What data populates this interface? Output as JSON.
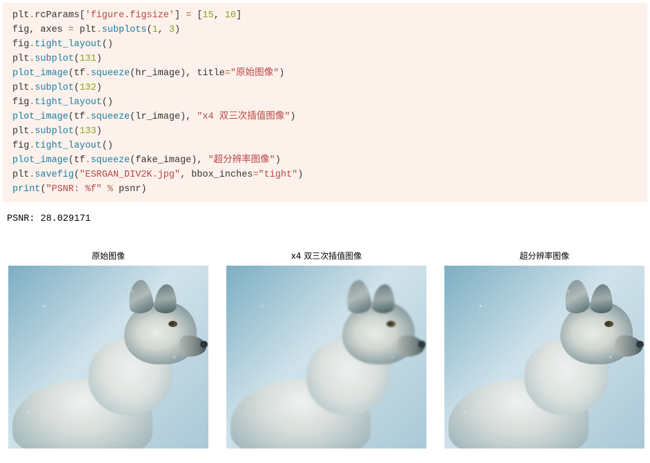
{
  "code": {
    "line1": {
      "a": "plt",
      "b": ".",
      "c": "rcParams",
      "d": "[",
      "e": "'figure.figsize'",
      "f": "]",
      "g": " ",
      "h": "=",
      "i": " [",
      "j": "15",
      "k": ", ",
      "l": "10",
      "m": "]"
    },
    "line2": {
      "a": "fig, axes ",
      "b": "=",
      "c": " plt",
      "d": ".",
      "e": "subplots",
      "f": "(",
      "g": "1",
      "h": ", ",
      "i": "3",
      "j": ")"
    },
    "line3": {
      "a": "fig",
      "b": ".",
      "c": "tight_layout",
      "d": "()"
    },
    "line4": {
      "a": "plt",
      "b": ".",
      "c": "subplot",
      "d": "(",
      "e": "131",
      "f": ")"
    },
    "line5": {
      "a": "plot_image",
      "b": "(tf",
      "c": ".",
      "d": "squeeze",
      "e": "(hr_image), title",
      "f": "=",
      "g": "\"原始图像\"",
      "h": ")"
    },
    "line6": {
      "a": "plt",
      "b": ".",
      "c": "subplot",
      "d": "(",
      "e": "132",
      "f": ")"
    },
    "line7": {
      "a": "fig",
      "b": ".",
      "c": "tight_layout",
      "d": "()"
    },
    "line8": {
      "a": "plot_image",
      "b": "(tf",
      "c": ".",
      "d": "squeeze",
      "e": "(lr_image), ",
      "f": "\"x4 双三次插值图像\"",
      "g": ")"
    },
    "line9": {
      "a": "plt",
      "b": ".",
      "c": "subplot",
      "d": "(",
      "e": "133",
      "f": ")"
    },
    "line10": {
      "a": "fig",
      "b": ".",
      "c": "tight_layout",
      "d": "()"
    },
    "line11": {
      "a": "plot_image",
      "b": "(tf",
      "c": ".",
      "d": "squeeze",
      "e": "(fake_image), ",
      "f": "\"超分辨率图像\"",
      "g": ")"
    },
    "line12": {
      "a": "plt",
      "b": ".",
      "c": "savefig",
      "d": "(",
      "e": "\"ESRGAN_DIV2K.jpg\"",
      "f": ", bbox_inches",
      "g": "=",
      "h": "\"tight\"",
      "i": ")"
    },
    "line13": {
      "a": "print",
      "b": "(",
      "c": "\"PSNR: %f\"",
      "d": " ",
      "e": "%",
      "f": " psnr)"
    }
  },
  "output": {
    "psnr_line": "PSNR: 28.029171"
  },
  "figure": {
    "subplots": [
      {
        "title": "原始图像"
      },
      {
        "title": "x4 双三次插值图像"
      },
      {
        "title": "超分辨率图像"
      }
    ]
  }
}
